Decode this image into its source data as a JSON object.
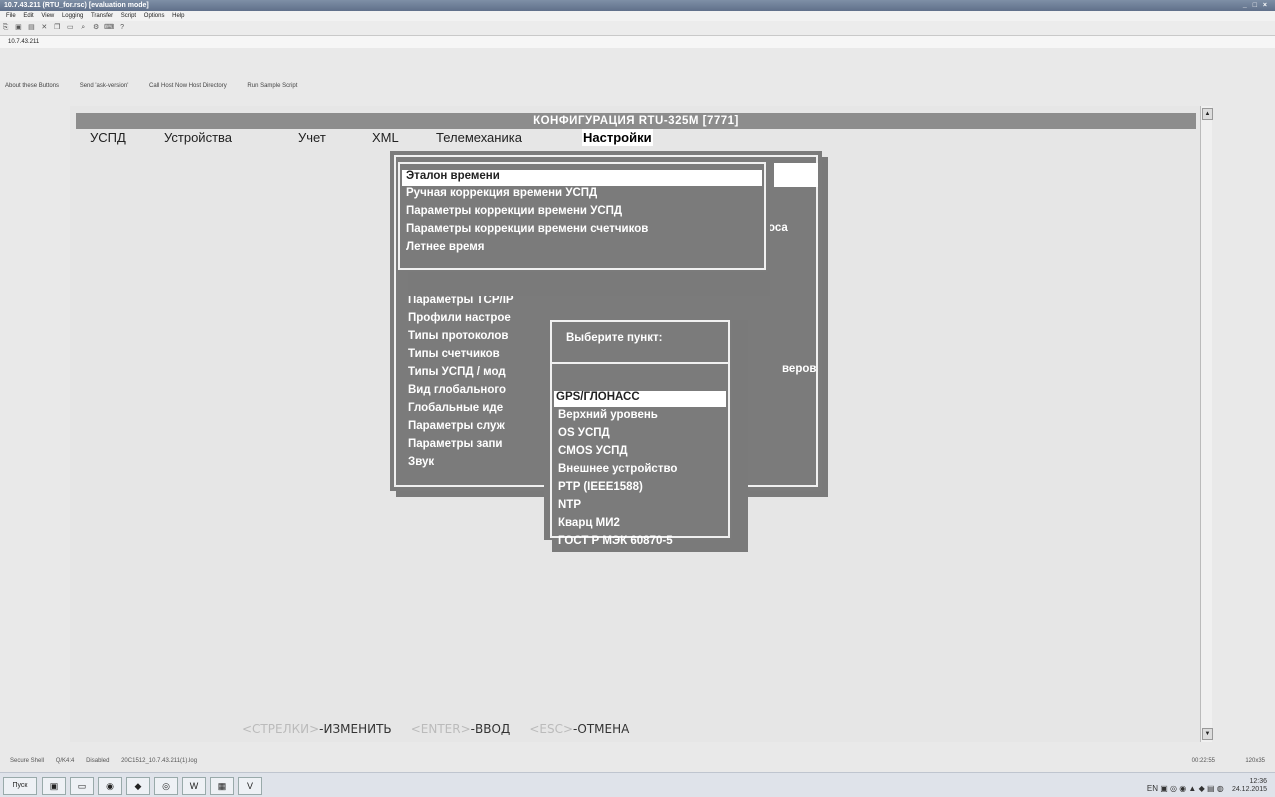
{
  "window": {
    "title": "10.7.43.211 (RTU_for.rsc) [evaluation mode]",
    "controls": "_ □ ×"
  },
  "menubar": [
    "File",
    "Edit",
    "View",
    "Logging",
    "Transfer",
    "Script",
    "Options",
    "Help"
  ],
  "address": "10.7.43.211",
  "links": [
    "About these Buttons",
    "Send 'ask-version'",
    "Call Host Now Host Directory",
    "Run Sample Script"
  ],
  "terminal": {
    "title": "КОНФИГУРАЦИЯ RTU-325M [7771]",
    "menu": [
      {
        "label": "УСПД"
      },
      {
        "label": "Устройства"
      },
      {
        "label": "Учет"
      },
      {
        "label": "XML"
      },
      {
        "label": "Телемеханика"
      },
      {
        "label": "Настройки"
      }
    ],
    "time_menu": [
      "Эталон времени",
      "Ручная коррекция времени УСПД",
      "Параметры коррекции времени УСПД",
      "Параметры коррекции времени счетчиков",
      "Летнее время"
    ],
    "time_menu_overflow": "оса",
    "settings_menu": [
      "Параметры TCP/IP",
      "Профили настрое",
      "Типы протоколов",
      "Типы счетчиков",
      "Типы УСПД / мод",
      "Вид глобального",
      "Глобальные иде",
      "Параметры служ",
      "Параметры запи",
      "Звук"
    ],
    "settings_overflow": "веров",
    "select_dialog": {
      "title": "Выберите пункт:",
      "items": [
        "GPS/ГЛОНАСС",
        "Верхний уровень",
        "OS УСПД",
        "CMOS УСПД",
        "Внешнее устройство",
        "PTP (IEEE1588)",
        "NTP",
        "Кварц МИ2",
        "ГОСТ Р МЭК 60870-5"
      ]
    },
    "hints": {
      "arrows_key": "<СТРЕЛКИ>",
      "arrows_action": "-ИЗМЕНИТЬ",
      "enter_key": "<ENTER>",
      "enter_action": "-ВВОД",
      "esc_key": "<ESC>",
      "esc_action": "-ОТМЕНА"
    }
  },
  "statusbar": [
    "Secure Shell",
    "Q/K4:4",
    "Disabled",
    "20C1512_10.7.43.211(1).log",
    "00:22:55",
    "120x35"
  ],
  "taskbar": {
    "start": "Пуск",
    "clock_time": "12:36",
    "clock_date": "24.12.2015"
  }
}
